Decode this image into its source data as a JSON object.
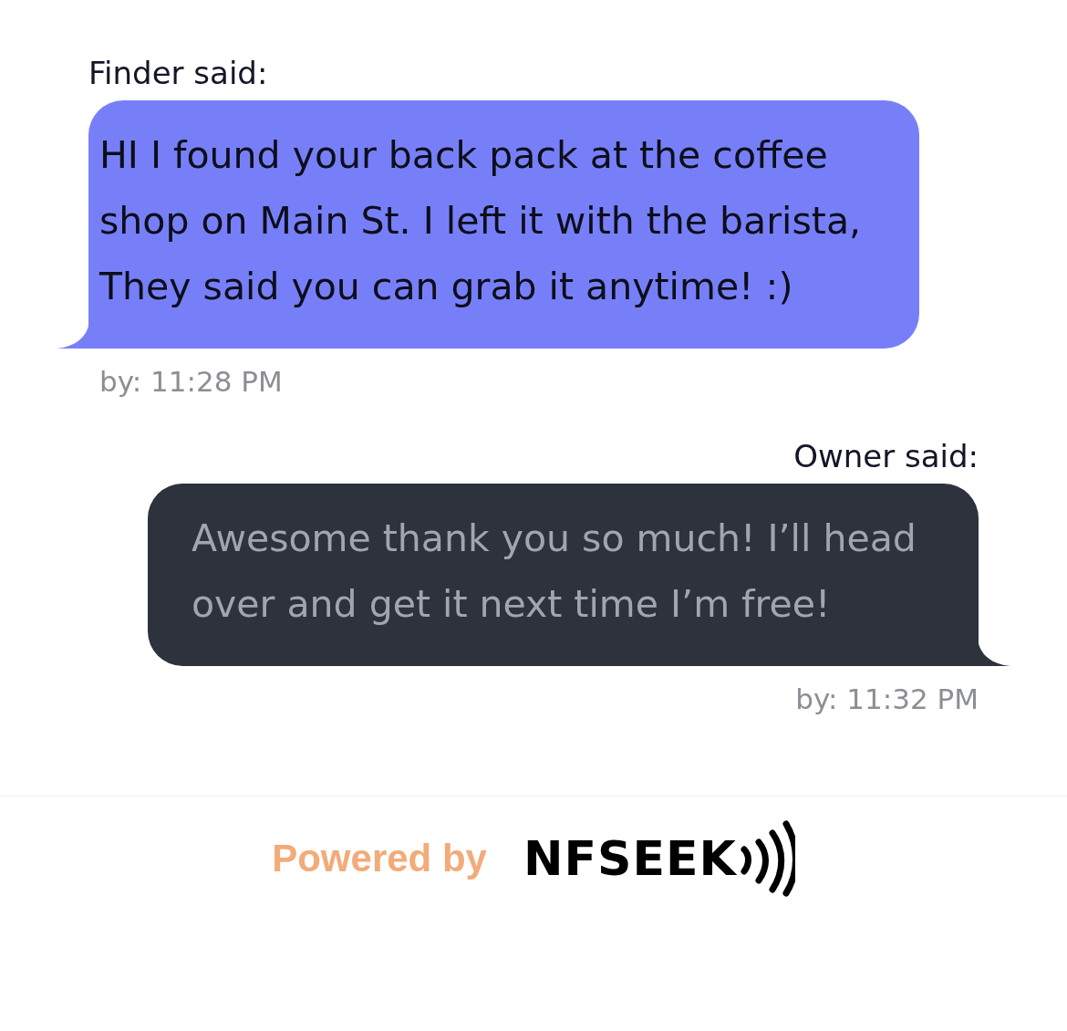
{
  "messages": [
    {
      "kind": "received",
      "sender": "Finder said:",
      "text": "HI I found your back pack at the coffee shop on Main St. I left it with the barista, They said you can grab it anytime! :)",
      "time": "by: 11:28 PM"
    },
    {
      "kind": "sent",
      "sender": "Owner said:",
      "text": "Awesome thank you so much! I’ll head over and get it next time I’m free!",
      "time": "by: 11:32 PM"
    }
  ],
  "footer": {
    "powered_by": "Powered by",
    "brand": "NFSEEK"
  }
}
